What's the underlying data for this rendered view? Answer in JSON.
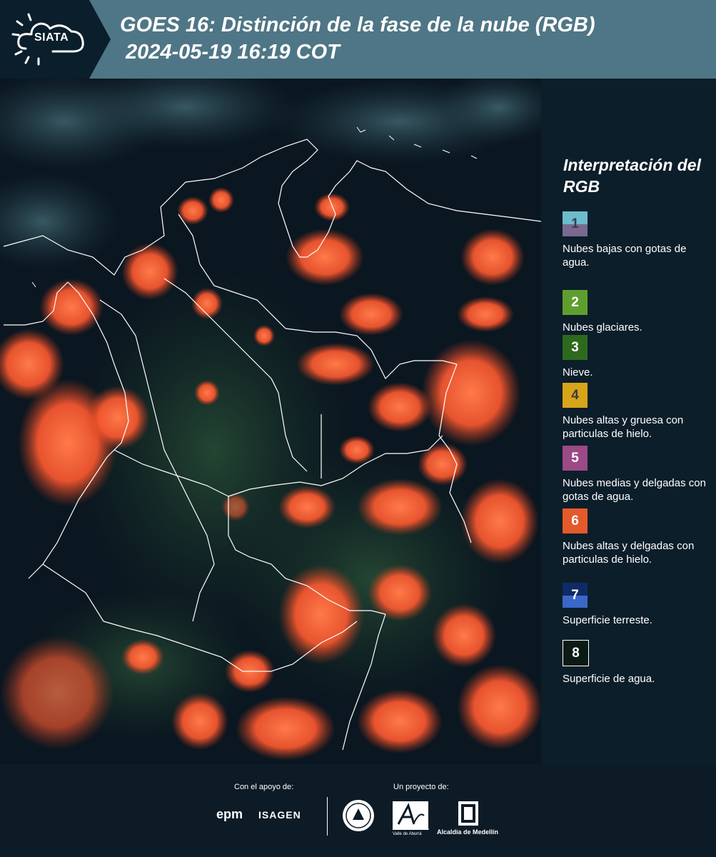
{
  "header": {
    "logo_text": "SIATA",
    "title_line1": "GOES 16: Distinción de la fase de la nube (RGB)",
    "title_line2": "2024-05-19 16:19 COT"
  },
  "legend": {
    "title": "Interpretación del RGB",
    "items": [
      {
        "num": "1",
        "label": "Nubes bajas con gotas de agua.",
        "color_top": "#6cbccb",
        "color_bottom": "#7a6a8f",
        "text_color": "#3b3b4b"
      },
      {
        "num": "2",
        "label": "Nubes glaciares.",
        "color_top": "#5f9e2e",
        "color_bottom": "#5f9e2e",
        "text_color": "#ffffff"
      },
      {
        "num": "3",
        "label": "Nieve.",
        "color_top": "#2e6a1e",
        "color_bottom": "#2e6a1e",
        "text_color": "#ffffff"
      },
      {
        "num": "4",
        "label": "Nubes altas y gruesa con particulas de hielo.",
        "color_top": "#d8a419",
        "color_bottom": "#d8a419",
        "text_color": "#3b3b3b"
      },
      {
        "num": "5",
        "label": "Nubes medias y delgadas con gotas de agua.",
        "color_top": "#9b4a86",
        "color_bottom": "#9b4a86",
        "text_color": "#ffffff"
      },
      {
        "num": "6",
        "label": "Nubes altas y delgadas con particulas de hielo.",
        "color_top": "#e35a2c",
        "color_bottom": "#e35a2c",
        "text_color": "#ffffff"
      },
      {
        "num": "7",
        "label": "Superficie terreste.",
        "color_top": "#0f2a66",
        "color_bottom": "#3a67c9",
        "text_color": "#ffffff"
      },
      {
        "num": "8",
        "label": "Superficie de agua.",
        "color_top": "#0a1a14",
        "color_bottom": "#0a1a14",
        "text_color": "#ffffff"
      }
    ]
  },
  "footer": {
    "support_label": "Con el apoyo de:",
    "project_label": "Un proyecto de:",
    "epm": "epm",
    "isagen": "ISAGEN",
    "area_label": "METROPOLITANA Valle de Aburrá",
    "alcaldia_label": "Alcaldía de Medellín"
  },
  "colors": {
    "header_bg": "#4f7686",
    "logo_bg": "#0b1e2b",
    "panel_bg": "#0c1e2a",
    "cloud_orange": "#ff6a3c",
    "background_dark": "#0a141c"
  }
}
